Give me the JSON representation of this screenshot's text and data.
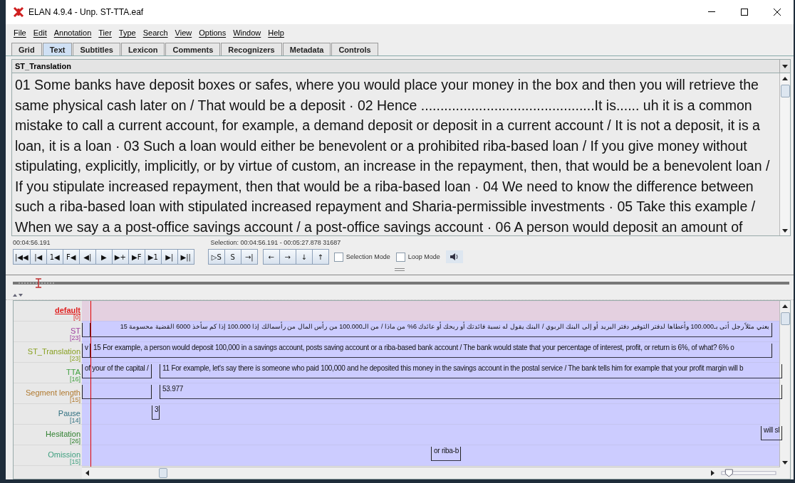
{
  "window": {
    "title": "ELAN 4.9.4 - Unp. ST-TTA.eaf"
  },
  "menu": [
    "File",
    "Edit",
    "Annotation",
    "Tier",
    "Type",
    "Search",
    "View",
    "Options",
    "Window",
    "Help"
  ],
  "tabs": [
    {
      "label": "Grid",
      "selected": false
    },
    {
      "label": "Text",
      "selected": true
    },
    {
      "label": "Subtitles",
      "selected": false
    },
    {
      "label": "Lexicon",
      "selected": false
    },
    {
      "label": "Comments",
      "selected": false
    },
    {
      "label": "Recognizers",
      "selected": false
    },
    {
      "label": "Metadata",
      "selected": false
    },
    {
      "label": "Controls",
      "selected": false
    }
  ],
  "text_view": {
    "tier": "ST_Translation",
    "text": "01 Some banks have deposit boxes or safes, where you would place your money in the box and then you will retrieve the same physical cash later on / That would be a deposit  ·  02 Hence .............................................It is...... uh it is a common mistake to call a current account, for example, a demand deposit or deposit in a current account / It is not a deposit, it is a loan, it is a loan  ·  03 Such a loan would either be benevolent or a prohibited riba-based loan / If you give money without stipulating, explicitly, implicitly, or by virtue of custom, an increase in the repayment, then, that would be a benevolent loan / If you stipulate increased repayment, then that would be a riba-based loan  ·  04 We need to know the difference between such a riba-based loan with stipulated increased repayment and Sharia-permissible investments  ·  05 Take this example / When we say a a post-office savings account / a post-office savings account  ·  06 A person would deposit an amount of"
  },
  "media": {
    "time": "00:04:56.191",
    "selection": "Selection: 00:04:56.191 - 00:05:27.878  31687",
    "button_groups": [
      [
        "|◀◀",
        "|◀",
        "1◀",
        "F◀",
        "◀|",
        "▶",
        "▶+",
        "▶F",
        "▶1",
        "▶|",
        "▶||"
      ],
      [
        "▷S",
        "S",
        "→|"
      ],
      [
        "←",
        "→",
        "↓",
        "↑"
      ]
    ],
    "options": [
      {
        "label": "Selection Mode",
        "checked": false
      },
      {
        "label": "Loop Mode",
        "checked": false
      }
    ]
  },
  "tiers": [
    {
      "name": "default",
      "count": "[0]",
      "color": "#e02020",
      "selected": true
    },
    {
      "name": "ST",
      "count": "[23]",
      "color": "#a040a0",
      "selected": false,
      "annotations": [
        {
          "kind": "blank"
        },
        {
          "kind": "text",
          "text": "بعني مثلاً رجل أتى بـ100.000 وأعطاها لدفتر التوفير دفتر البريد أو إلى البنك الربوي / البنك يقول له نسبة فائدتك أو ربحك أو عائدك 6% من ماذا / من الـ100.000 من رأس المال من رأسمالك إذا 100.000 إذا كم سأخذ 6000 القضية محسومة 15"
        }
      ]
    },
    {
      "name": "ST_Translation",
      "count": "[23]",
      "color": "#88a020",
      "selected": false,
      "annotations": [
        {
          "kind": "text",
          "text": "v"
        },
        {
          "kind": "text",
          "text": "15 For example, a person would deposit 100,000 in a savings account, posts saving account or a riba-based bank account / The bank would state that your percentage of interest, profit, or return is 6%, of what? 6% o"
        }
      ]
    },
    {
      "name": "TTA",
      "count": "[16]",
      "color": "#40a040",
      "selected": false,
      "annotations": [
        {
          "kind": "text",
          "text": "of your of the capital /"
        },
        {
          "kind": "text",
          "text": "11 For example, let's say there is someone who paid 100,000 and he deposited this money in the savings account in the postal service / The bank tells him for example that your profit margin will b"
        }
      ]
    },
    {
      "name": "Segment length",
      "count": "[15]",
      "color": "#b07a30",
      "selected": false,
      "annotations": [
        {
          "kind": "blank"
        },
        {
          "kind": "text",
          "text": "53.977"
        }
      ]
    },
    {
      "name": "Pause",
      "count": "[14]",
      "color": "#307080",
      "selected": false,
      "annotations": [
        {
          "kind": "text",
          "text": "3"
        }
      ]
    },
    {
      "name": "Hesitation",
      "count": "[26]",
      "color": "#308030",
      "selected": false,
      "annotations": [
        {
          "kind": "text",
          "text": "will sl"
        }
      ]
    },
    {
      "name": "Omission",
      "count": "[15]",
      "color": "#40a080",
      "selected": false,
      "annotations": [
        {
          "kind": "text",
          "text": "or riba-b"
        }
      ]
    }
  ],
  "zoom": {
    "level": 0.05
  }
}
